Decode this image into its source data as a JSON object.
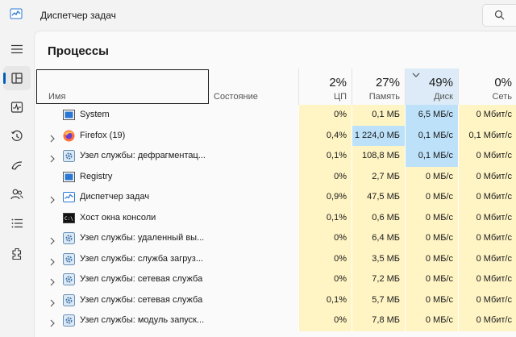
{
  "window": {
    "title": "Диспетчер задач"
  },
  "sidebar": {
    "items": [
      {
        "name": "menu-icon"
      },
      {
        "name": "processes-icon",
        "active": true
      },
      {
        "name": "performance-icon"
      },
      {
        "name": "app-history-icon"
      },
      {
        "name": "startup-apps-icon"
      },
      {
        "name": "users-icon"
      },
      {
        "name": "details-icon"
      },
      {
        "name": "services-icon"
      }
    ]
  },
  "page": {
    "title": "Процессы"
  },
  "columns": {
    "name": "Имя",
    "status": "Состояние",
    "cpu": {
      "pct": "2%",
      "label": "ЦП"
    },
    "memory": {
      "pct": "27%",
      "label": "Память"
    },
    "disk": {
      "pct": "49%",
      "label": "Диск"
    },
    "network": {
      "pct": "0%",
      "label": "Сеть"
    }
  },
  "rows": [
    {
      "name": "System",
      "icon": "system-icon",
      "expandable": false,
      "cpu": "0%",
      "memory": "0,1 МБ",
      "disk": "6,5 МБ/с",
      "network": "0 Мбит/с"
    },
    {
      "name": "Firefox (19)",
      "icon": "firefox-icon",
      "expandable": true,
      "eco": true,
      "cpu": "0,4%",
      "memory": "1 224,0 МБ",
      "disk": "0,1 МБ/с",
      "network": "0,1 Мбит/с"
    },
    {
      "name": "Узел службы: дефрагментац...",
      "icon": "gear-icon",
      "expandable": true,
      "cpu": "0,1%",
      "memory": "108,8 МБ",
      "disk": "0,1 МБ/с",
      "network": "0 Мбит/с"
    },
    {
      "name": "Registry",
      "icon": "system-icon",
      "expandable": false,
      "cpu": "0%",
      "memory": "2,7 МБ",
      "disk": "0 МБ/с",
      "network": "0 Мбит/с"
    },
    {
      "name": "Диспетчер задач",
      "icon": "task-manager-icon",
      "expandable": true,
      "cpu": "0,9%",
      "memory": "47,5 МБ",
      "disk": "0 МБ/с",
      "network": "0 Мбит/с"
    },
    {
      "name": "Хост окна консоли",
      "icon": "console-icon",
      "expandable": false,
      "cpu": "0,1%",
      "memory": "0,6 МБ",
      "disk": "0 МБ/с",
      "network": "0 Мбит/с"
    },
    {
      "name": "Узел службы: удаленный вы...",
      "icon": "gear-icon",
      "expandable": true,
      "cpu": "0%",
      "memory": "6,4 МБ",
      "disk": "0 МБ/с",
      "network": "0 Мбит/с"
    },
    {
      "name": "Узел службы: служба загруз...",
      "icon": "gear-icon",
      "expandable": true,
      "cpu": "0%",
      "memory": "3,5 МБ",
      "disk": "0 МБ/с",
      "network": "0 Мбит/с"
    },
    {
      "name": "Узел службы: сетевая служба",
      "icon": "gear-icon",
      "expandable": true,
      "cpu": "0%",
      "memory": "7,2 МБ",
      "disk": "0 МБ/с",
      "network": "0 Мбит/с"
    },
    {
      "name": "Узел службы: сетевая служба",
      "icon": "gear-icon",
      "expandable": true,
      "cpu": "0,1%",
      "memory": "5,7 МБ",
      "disk": "0 МБ/с",
      "network": "0 Мбит/с"
    },
    {
      "name": "Узел службы: модуль запуск...",
      "icon": "gear-icon",
      "expandable": true,
      "cpu": "0%",
      "memory": "7,8 МБ",
      "disk": "0 МБ/с",
      "network": "0 Мбит/с"
    }
  ],
  "colors": {
    "cell_light": "#fff4c4",
    "cell_medium": "#f9ec9e",
    "cell_dark": "#bde1f9",
    "accent": "#005fb8"
  }
}
